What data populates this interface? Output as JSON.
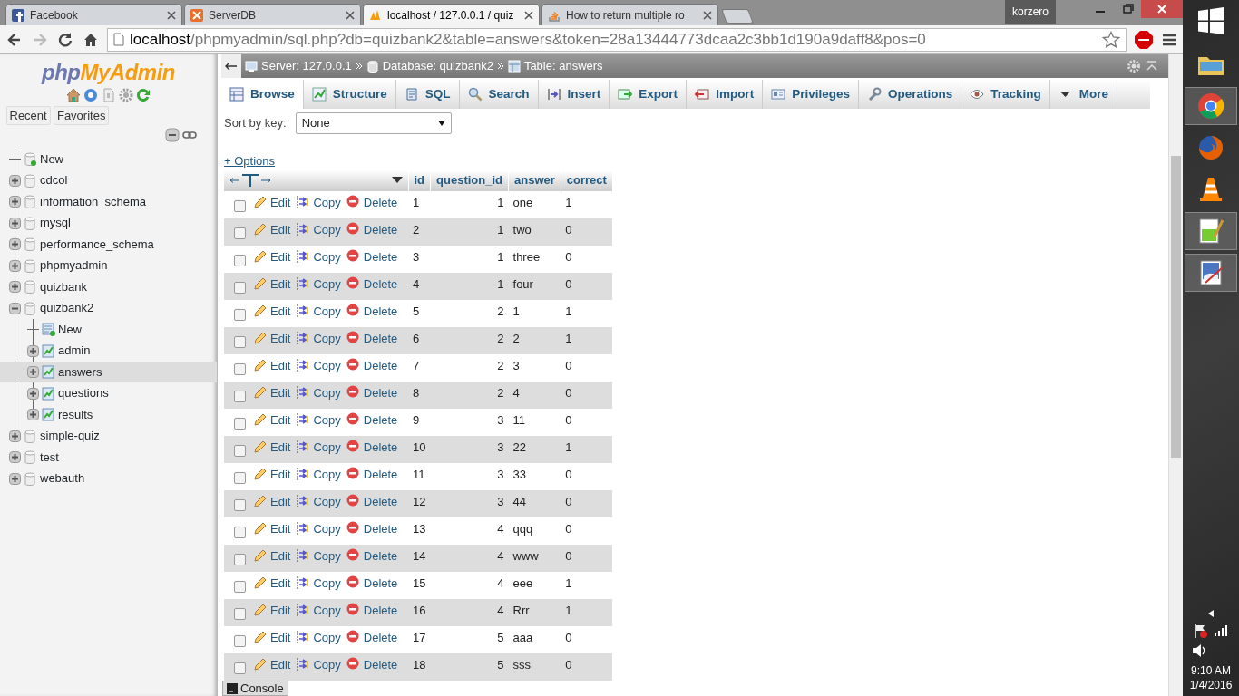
{
  "browser": {
    "tabs": [
      {
        "title": "Facebook",
        "kind": "facebook",
        "selected": false
      },
      {
        "title": "ServerDB",
        "kind": "server",
        "selected": false
      },
      {
        "title": "localhost / 127.0.0.1 / quiz",
        "kind": "pma",
        "selected": true
      },
      {
        "title": "How to return multiple ro",
        "kind": "stack",
        "selected": false
      }
    ],
    "user": "korzero",
    "address": {
      "host": "localhost",
      "path": "/phpmyadmin/sql.php?db=quizbank2&table=answers&token=28a13444773dcaa2c3bb1d190a9daff8&pos=0"
    }
  },
  "sidebar": {
    "logo": {
      "part_1": "php",
      "part_2": "MyAdmin"
    },
    "buttons": [
      "Recent",
      "Favorites"
    ],
    "tree": [
      {
        "label": "New",
        "kind": "new"
      },
      {
        "label": "cdcol",
        "kind": "db",
        "expanded": false
      },
      {
        "label": "information_schema",
        "kind": "db",
        "expanded": false
      },
      {
        "label": "mysql",
        "kind": "db",
        "expanded": false
      },
      {
        "label": "performance_schema",
        "kind": "db",
        "expanded": false
      },
      {
        "label": "phpmyadmin",
        "kind": "db",
        "expanded": false
      },
      {
        "label": "quizbank",
        "kind": "db",
        "expanded": false
      },
      {
        "label": "quizbank2",
        "kind": "db",
        "expanded": true,
        "children": [
          {
            "label": "New",
            "kind": "new_table",
            "selected": false
          },
          {
            "label": "admin",
            "kind": "table",
            "selected": false
          },
          {
            "label": "answers",
            "kind": "table",
            "selected": true
          },
          {
            "label": "questions",
            "kind": "table",
            "selected": false
          },
          {
            "label": "results",
            "kind": "table",
            "selected": false
          }
        ]
      },
      {
        "label": "simple-quiz",
        "kind": "db",
        "expanded": false
      },
      {
        "label": "test",
        "kind": "db",
        "expanded": false
      },
      {
        "label": "webauth",
        "kind": "db",
        "expanded": false
      }
    ]
  },
  "main": {
    "breadcrumb": [
      {
        "label": "Server: 127.0.0.1",
        "kind": "server"
      },
      {
        "label": "Database: quizbank2",
        "kind": "database"
      },
      {
        "label": "Table: answers",
        "kind": "table"
      }
    ],
    "tabs": [
      {
        "label": "Browse",
        "kind": "browse",
        "selected": true
      },
      {
        "label": "Structure",
        "kind": "structure",
        "selected": false
      },
      {
        "label": "SQL",
        "kind": "sql",
        "selected": false
      },
      {
        "label": "Search",
        "kind": "search",
        "selected": false
      },
      {
        "label": "Insert",
        "kind": "insert",
        "selected": false
      },
      {
        "label": "Export",
        "kind": "export",
        "selected": false
      },
      {
        "label": "Import",
        "kind": "import",
        "selected": false
      },
      {
        "label": "Privileges",
        "kind": "privileges",
        "selected": false
      },
      {
        "label": "Operations",
        "kind": "operations",
        "selected": false
      },
      {
        "label": "Tracking",
        "kind": "tracking",
        "selected": false
      },
      {
        "label": "More",
        "kind": "more",
        "selected": false
      }
    ],
    "sort_label": "Sort by key:",
    "sort_value": "None",
    "options": "+ Options",
    "columns": [
      "id",
      "question_id",
      "answer",
      "correct"
    ],
    "rows": [
      {
        "checked": false,
        "edit": "Edit",
        "copy": "Copy",
        "delete": "Delete",
        "id": "1",
        "question_id": "1",
        "answer": "one",
        "correct": "1"
      },
      {
        "checked": false,
        "edit": "Edit",
        "copy": "Copy",
        "delete": "Delete",
        "id": "2",
        "question_id": "1",
        "answer": "two",
        "correct": "0"
      },
      {
        "checked": false,
        "edit": "Edit",
        "copy": "Copy",
        "delete": "Delete",
        "id": "3",
        "question_id": "1",
        "answer": "three",
        "correct": "0"
      },
      {
        "checked": false,
        "edit": "Edit",
        "copy": "Copy",
        "delete": "Delete",
        "id": "4",
        "question_id": "1",
        "answer": "four",
        "correct": "0"
      },
      {
        "checked": false,
        "edit": "Edit",
        "copy": "Copy",
        "delete": "Delete",
        "id": "5",
        "question_id": "2",
        "answer": "1",
        "correct": "1"
      },
      {
        "checked": false,
        "edit": "Edit",
        "copy": "Copy",
        "delete": "Delete",
        "id": "6",
        "question_id": "2",
        "answer": "2",
        "correct": "1"
      },
      {
        "checked": false,
        "edit": "Edit",
        "copy": "Copy",
        "delete": "Delete",
        "id": "7",
        "question_id": "2",
        "answer": "3",
        "correct": "0"
      },
      {
        "checked": false,
        "edit": "Edit",
        "copy": "Copy",
        "delete": "Delete",
        "id": "8",
        "question_id": "2",
        "answer": "4",
        "correct": "0"
      },
      {
        "checked": false,
        "edit": "Edit",
        "copy": "Copy",
        "delete": "Delete",
        "id": "9",
        "question_id": "3",
        "answer": "11",
        "correct": "0"
      },
      {
        "checked": false,
        "edit": "Edit",
        "copy": "Copy",
        "delete": "Delete",
        "id": "10",
        "question_id": "3",
        "answer": "22",
        "correct": "1"
      },
      {
        "checked": false,
        "edit": "Edit",
        "copy": "Copy",
        "delete": "Delete",
        "id": "11",
        "question_id": "3",
        "answer": "33",
        "correct": "0"
      },
      {
        "checked": false,
        "edit": "Edit",
        "copy": "Copy",
        "delete": "Delete",
        "id": "12",
        "question_id": "3",
        "answer": "44",
        "correct": "0"
      },
      {
        "checked": false,
        "edit": "Edit",
        "copy": "Copy",
        "delete": "Delete",
        "id": "13",
        "question_id": "4",
        "answer": "qqq",
        "correct": "0"
      },
      {
        "checked": false,
        "edit": "Edit",
        "copy": "Copy",
        "delete": "Delete",
        "id": "14",
        "question_id": "4",
        "answer": "www",
        "correct": "0"
      },
      {
        "checked": false,
        "edit": "Edit",
        "copy": "Copy",
        "delete": "Delete",
        "id": "15",
        "question_id": "4",
        "answer": "eee",
        "correct": "1"
      },
      {
        "checked": false,
        "edit": "Edit",
        "copy": "Copy",
        "delete": "Delete",
        "id": "16",
        "question_id": "4",
        "answer": "Rrr",
        "correct": "1"
      },
      {
        "checked": false,
        "edit": "Edit",
        "copy": "Copy",
        "delete": "Delete",
        "id": "17",
        "question_id": "5",
        "answer": "aaa",
        "correct": "0"
      },
      {
        "checked": false,
        "edit": "Edit",
        "copy": "Copy",
        "delete": "Delete",
        "id": "18",
        "question_id": "5",
        "answer": "sss",
        "correct": "0"
      }
    ],
    "console": "Console"
  },
  "taskbar": {
    "apps": [
      {
        "kind": "folder",
        "selected": false
      },
      {
        "kind": "chrome",
        "selected": true
      },
      {
        "kind": "firefox",
        "selected": false
      },
      {
        "kind": "vlc",
        "selected": false
      },
      {
        "kind": "notepad",
        "selected": true
      },
      {
        "kind": "paint",
        "selected": true
      }
    ],
    "time": "9:10 AM",
    "date": "1/4/2016"
  }
}
